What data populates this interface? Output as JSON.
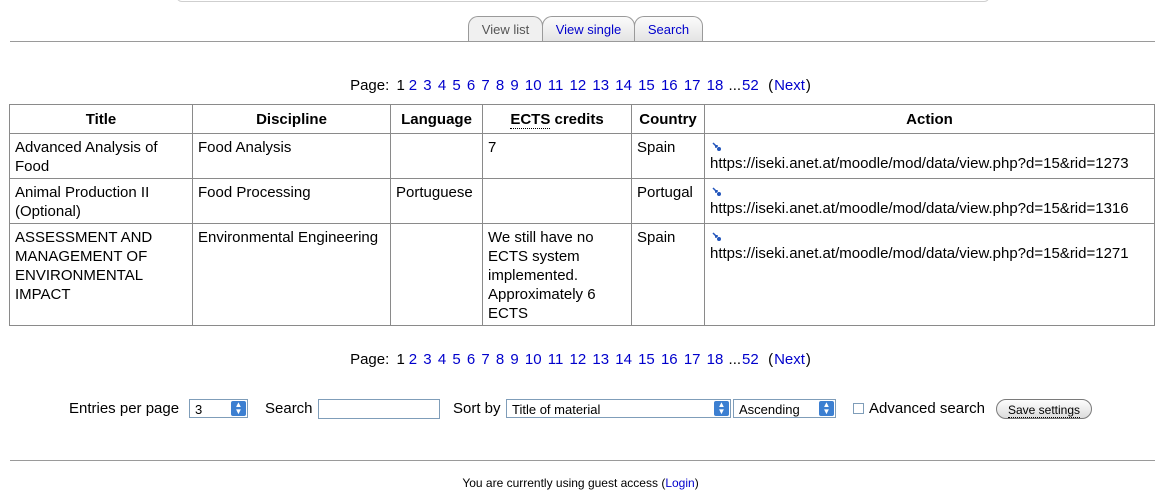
{
  "tabs": [
    "View list",
    "View single",
    "Search"
  ],
  "paging": {
    "label": "Page:",
    "current": "1",
    "pages": [
      "2",
      "3",
      "4",
      "5",
      "6",
      "7",
      "8",
      "9",
      "10",
      "11",
      "12",
      "13",
      "14",
      "15",
      "16",
      "17",
      "18"
    ],
    "ellipsis": "...",
    "last": "52",
    "next": "Next"
  },
  "table": {
    "headers": [
      "Title",
      "Discipline",
      "Language",
      "ECTS credits",
      "Country",
      "Action"
    ],
    "rows": [
      {
        "title": "Advanced Analysis of Food",
        "discipline": "Food Analysis",
        "language": "",
        "ects": "7",
        "country": "Spain",
        "url": "https://iseki.anet.at/moodle/mod/data/view.php?d=15&rid=1273"
      },
      {
        "title": "Animal Production II (Optional)",
        "discipline": "Food Processing",
        "language": "Portuguese",
        "ects": "",
        "country": "Portugal",
        "url": "https://iseki.anet.at/moodle/mod/data/view.php?d=15&rid=1316"
      },
      {
        "title": "ASSESSMENT AND MANAGEMENT OF ENVIRONMENTAL IMPACT",
        "discipline": "Environmental Engineering",
        "language": "",
        "ects": "We still have no ECTS system implemented. Approximately 6 ECTS",
        "country": "Spain",
        "url": "https://iseki.anet.at/moodle/mod/data/view.php?d=15&rid=1271"
      }
    ]
  },
  "controls": {
    "entries_label": "Entries per page",
    "entries_value": "3",
    "search_label": "Search",
    "search_value": "",
    "sort_label": "Sort by",
    "sort_value": "Title of material",
    "order_value": "Ascending",
    "advanced_label": "Advanced search",
    "save_label": "Save settings"
  },
  "footer": {
    "text": "You are currently using guest access (",
    "login": "Login",
    "close": ")"
  }
}
